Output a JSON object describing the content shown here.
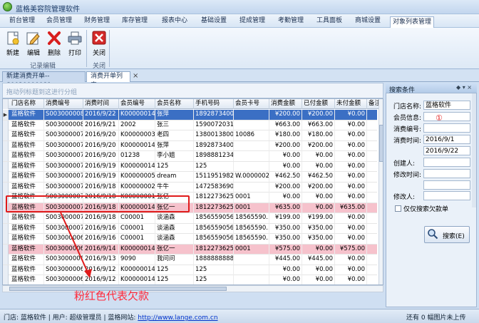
{
  "window": {
    "title": "蓝格美容院管理软件"
  },
  "menu": [
    "前台管理",
    "会员管理",
    "财务管理",
    "库存管理",
    "报表中心",
    "基础设置",
    "提成管理",
    "考勤管理",
    "工具面板",
    "商城设置",
    "对象列表管理"
  ],
  "menu_active": 10,
  "ribbon": {
    "buttons": [
      "新建",
      "编辑",
      "删除",
      "打印",
      "关闭"
    ],
    "groups": [
      "记录编辑",
      "关闭"
    ]
  },
  "doc_tabs": [
    "新建消费开单--S0030000081",
    "消费开单列表"
  ],
  "grid": {
    "group_hint": "拖动列标题到这进行分组",
    "columns": [
      "门店名称",
      "消费编号",
      "消费时间",
      "会员编号",
      "会员名称",
      "手机号码",
      "会员卡号",
      "消费金额",
      "已付金额",
      "未付金额",
      "备注"
    ],
    "rows": [
      [
        "蓝格软件",
        "S0030000081",
        "2016/9/22",
        "K00000014",
        "张萍",
        "18928734000",
        "",
        "¥200.00",
        "¥200.00",
        "¥0.00"
      ],
      [
        "蓝格软件",
        "S0030000080",
        "2016/9/21",
        "2002",
        "张三",
        "15900720312",
        "",
        "¥663.00",
        "¥663.00",
        "¥0.00"
      ],
      [
        "蓝格软件",
        "S0030000079",
        "2016/9/20",
        "K00000003",
        "老四",
        "13800138000",
        "10086",
        "¥180.00",
        "¥180.00",
        "¥0.00"
      ],
      [
        "蓝格软件",
        "S0030000078",
        "2016/9/20",
        "K00000014",
        "张萍",
        "18928734000",
        "",
        "¥200.00",
        "¥200.00",
        "¥0.00"
      ],
      [
        "蓝格软件",
        "S0030000077",
        "2016/9/20",
        "01238",
        "李小姐",
        "18988812345",
        "",
        "¥0.00",
        "¥0.00",
        "¥0.00"
      ],
      [
        "蓝格软件",
        "S0030000076",
        "2016/9/19",
        "K00000014",
        "125",
        "125",
        "",
        "¥0.00",
        "¥0.00",
        "¥0.00"
      ],
      [
        "蓝格软件",
        "S0030000075",
        "2016/9/19",
        "K00000005",
        "dream",
        "15119519824",
        "W.0000002",
        "¥462.50",
        "¥462.50",
        "¥0.00"
      ],
      [
        "蓝格软件",
        "S0030000074",
        "2016/9/18",
        "K00000002",
        "牛牛",
        "14725836900",
        "",
        "¥200.00",
        "¥200.00",
        "¥0.00"
      ],
      [
        "蓝格软件",
        "S0030000073",
        "2016/9/18",
        "K00000001",
        "张亿一",
        "18122736255",
        "0001",
        "¥0.00",
        "¥0.00",
        "¥0.00"
      ],
      [
        "蓝格软件",
        "S0030000072",
        "2016/9/18",
        "K00000014",
        "张亿一",
        "18122736255",
        "0001",
        "¥635.00",
        "¥0.00",
        "¥635.00"
      ],
      [
        "蓝格软件",
        "S0030000071",
        "2016/9/18",
        "C00001",
        "谈涵森",
        "18565590567",
        "18565590...",
        "¥199.00",
        "¥199.00",
        "¥0.00"
      ],
      [
        "蓝格软件",
        "S0030000070",
        "2016/9/16",
        "C00001",
        "谈涵森",
        "18565590567",
        "18565590...",
        "¥350.00",
        "¥350.00",
        "¥0.00"
      ],
      [
        "蓝格软件",
        "S0030000069",
        "2016/9/16",
        "C00001",
        "谈涵森",
        "18565590567",
        "18565590...",
        "¥350.00",
        "¥350.00",
        "¥0.00"
      ],
      [
        "蓝格软件",
        "S0030000068",
        "2016/9/14",
        "K00000014",
        "张亿一",
        "18122736255",
        "0001",
        "¥575.00",
        "¥0.00",
        "¥575.00"
      ],
      [
        "蓝格软件",
        "S0030000067",
        "2016/9/13",
        "9090",
        "我问问",
        "18888888888",
        "",
        "¥445.00",
        "¥445.00",
        "¥0.00"
      ],
      [
        "蓝格软件",
        "S0030000066",
        "2016/9/12",
        "K00000014",
        "125",
        "125",
        "",
        "¥0.00",
        "¥0.00",
        "¥0.00"
      ],
      [
        "蓝格软件",
        "S0030000065",
        "2016/9/12",
        "K00000014",
        "125",
        "125",
        "",
        "¥0.00",
        "¥0.00",
        "¥0.00"
      ],
      [
        "蓝格软件",
        "S0030000064",
        "2016/9/12",
        "K00000014",
        "张亿一",
        "18122736255",
        "0001",
        "¥635.00",
        "¥635.00",
        "¥0.00"
      ]
    ],
    "selected_row": 0,
    "pink_rows": [
      9,
      13
    ]
  },
  "search_panel": {
    "title": "搜索条件",
    "fields": [
      {
        "label": "门店名称:",
        "value": "蓝格软件"
      },
      {
        "label": "会员信息:",
        "value": ""
      },
      {
        "label": "消费编号:",
        "value": ""
      },
      {
        "label": "消费时间:",
        "value": "2016/9/1"
      },
      {
        "label": "",
        "value": "2016/9/22"
      },
      {
        "label": "创建人:",
        "value": ""
      },
      {
        "label": "修改时间:",
        "value": ""
      },
      {
        "label": "",
        "value": ""
      },
      {
        "label": "修改人:",
        "value": ""
      }
    ],
    "marker": "①",
    "checkbox_label": "仅仅搜索欠款单",
    "search_button": "搜索(E)"
  },
  "status": {
    "store": "门店: 蓝格软件",
    "user": "用户: 超级管理员",
    "site_label": "蓝格网站:",
    "site_url": "http://www.lange.com.cn",
    "right": "还有 0 幅图片未上传"
  },
  "annotation": "粉红色代表欠款",
  "colors": {
    "selected": "#3b6fc4",
    "debt_row": "#f6c2cc",
    "annotation": "#ff2a3a"
  }
}
